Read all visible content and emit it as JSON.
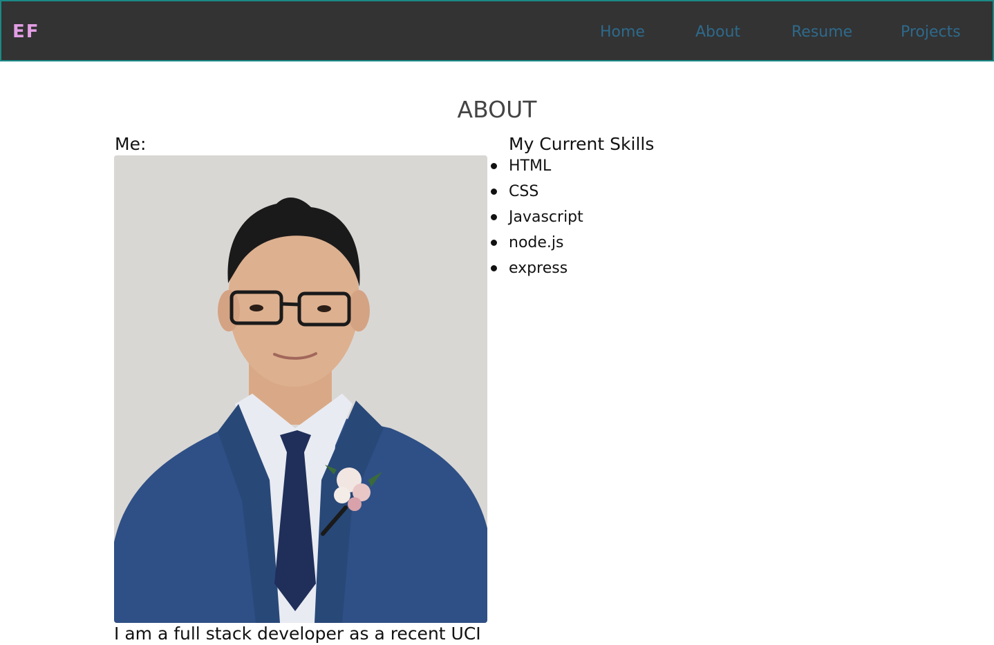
{
  "navbar": {
    "brand": "EF",
    "links": [
      "Home",
      "About",
      "Resume",
      "Projects"
    ]
  },
  "about": {
    "title": "ABOUT",
    "me_label": "Me:",
    "bio_partial": "I am a full stack developer as a recent UCI"
  },
  "skills": {
    "title": "My Current Skills",
    "items": [
      "HTML",
      "CSS",
      "Javascript",
      "node.js",
      "express"
    ]
  },
  "colors": {
    "navbar_bg": "#333333",
    "navbar_border": "#1a8a87",
    "brand": "#e39ee4",
    "nav_link": "#2e6a8c"
  }
}
